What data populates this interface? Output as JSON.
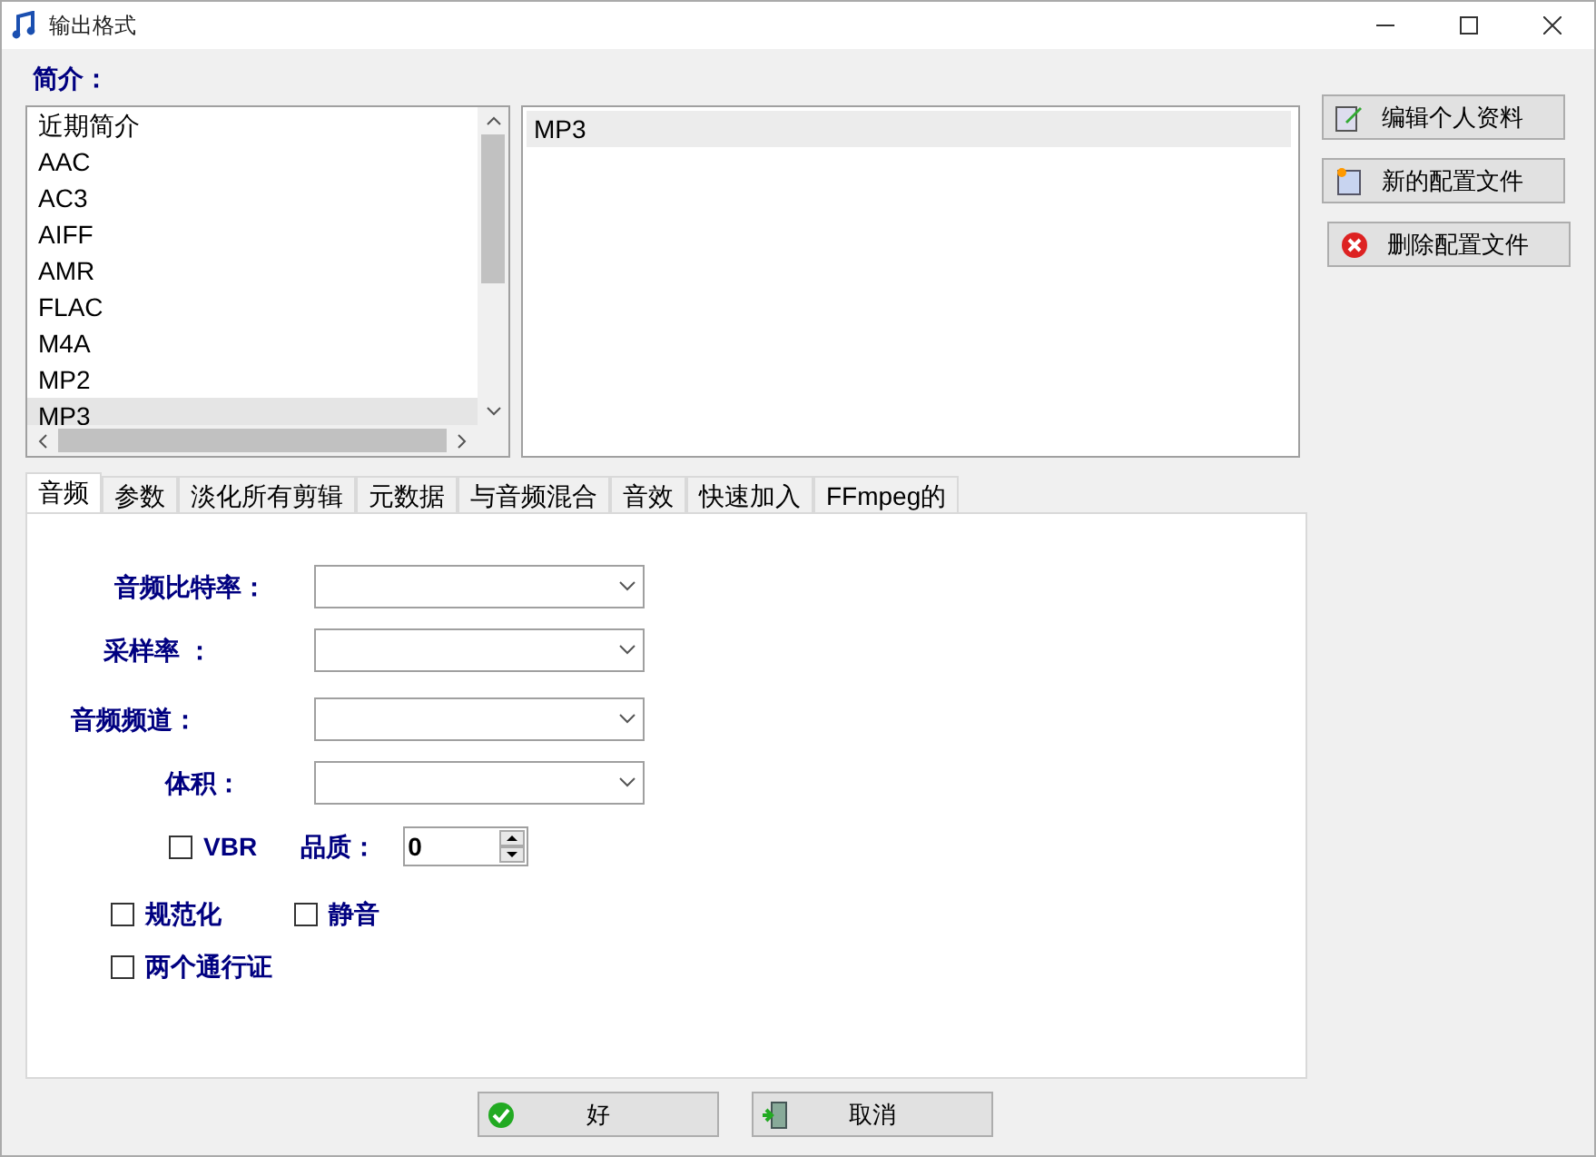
{
  "window": {
    "title": "输出格式"
  },
  "profiles_label": "简介：",
  "profiles": [
    {
      "label": "近期简介",
      "selected": false
    },
    {
      "label": "AAC",
      "selected": false
    },
    {
      "label": "AC3",
      "selected": false
    },
    {
      "label": "AIFF",
      "selected": false
    },
    {
      "label": "AMR",
      "selected": false
    },
    {
      "label": "FLAC",
      "selected": false
    },
    {
      "label": "M4A",
      "selected": false
    },
    {
      "label": "MP2",
      "selected": false
    },
    {
      "label": "MP3",
      "selected": true
    }
  ],
  "details": [
    {
      "label": "MP3",
      "selected": true
    }
  ],
  "side_buttons": [
    {
      "label": "编辑个人资料",
      "kind": "edit"
    },
    {
      "label": "新的配置文件",
      "kind": "new"
    },
    {
      "label": "删除配置文件",
      "kind": "delete"
    }
  ],
  "tabs": [
    {
      "label": "音频",
      "selected": true
    },
    {
      "label": "参数",
      "selected": false
    },
    {
      "label": "淡化所有剪辑",
      "selected": false
    },
    {
      "label": "元数据",
      "selected": false
    },
    {
      "label": "与音频混合",
      "selected": false
    },
    {
      "label": "音效",
      "selected": false
    },
    {
      "label": "快速加入",
      "selected": false
    },
    {
      "label": "FFmpeg的",
      "selected": false
    }
  ],
  "fields": [
    {
      "label": "音频比特率："
    },
    {
      "label": "采样率 ："
    },
    {
      "label": "音频频道："
    },
    {
      "label": "体积："
    }
  ],
  "vbr": {
    "label": "VBR",
    "checked": false
  },
  "quality": {
    "label": "品质：",
    "value": "0"
  },
  "options": [
    {
      "label": "规范化",
      "checked": false
    },
    {
      "label": "静音",
      "checked": false
    },
    {
      "label": "两个通行证",
      "checked": false
    }
  ],
  "buttons": [
    {
      "label": "好",
      "kind": "ok"
    },
    {
      "label": "取消",
      "kind": "cancel"
    }
  ]
}
